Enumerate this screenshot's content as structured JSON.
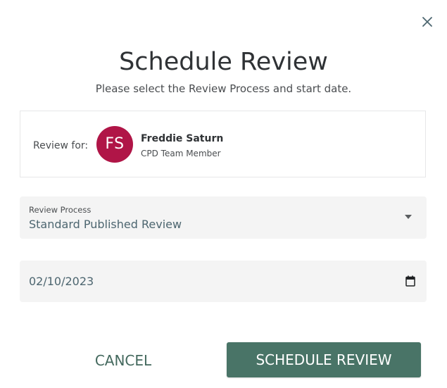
{
  "dialog": {
    "title": "Schedule Review",
    "subtitle": "Please select the Review Process and start date.",
    "close_icon": "close-icon"
  },
  "review_for": {
    "label": "Review for:",
    "avatar_initials": "FS",
    "avatar_color": "#b01547",
    "name": "Freddie Saturn",
    "role": "CPD Team Member"
  },
  "review_process": {
    "label": "Review Process",
    "selected": "Standard Published Review",
    "icon": "caret-down-icon"
  },
  "start_date": {
    "value": "02/10/2023",
    "icon": "calendar-icon"
  },
  "actions": {
    "cancel_label": "CANCEL",
    "schedule_label": "SCHEDULE REVIEW",
    "accent_color": "#497467"
  }
}
